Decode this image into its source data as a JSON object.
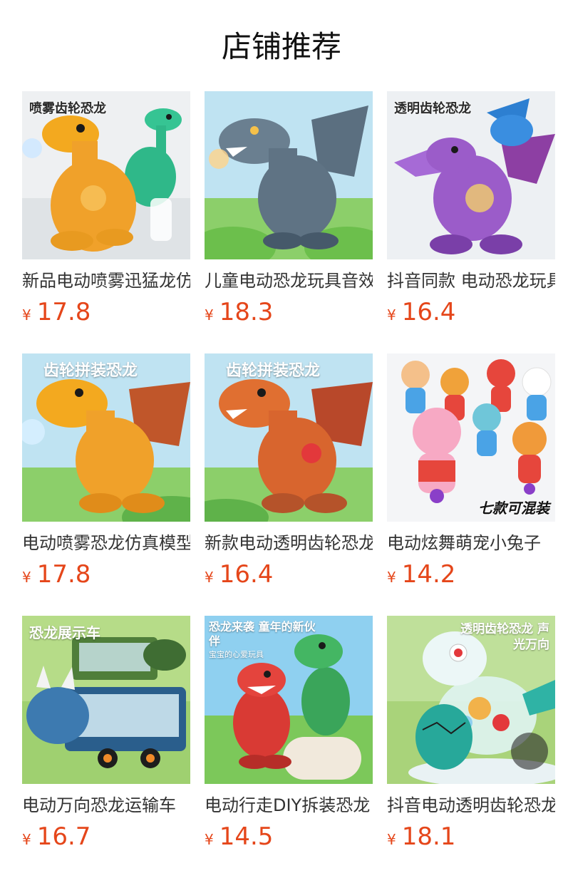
{
  "section": {
    "title": "店铺推荐"
  },
  "colors": {
    "price": "#e5461a",
    "title": "#111111",
    "name": "#333333"
  },
  "products": [
    {
      "name": "新品电动喷雾迅猛龙仿真模型",
      "currency": "¥",
      "price": "17.8",
      "image_label": "喷雾齿轮恐龙",
      "image_icon": "orange-dinosaur-image"
    },
    {
      "name": "儿童电动恐龙玩具音效",
      "currency": "¥",
      "price": "18.3",
      "image_label": "",
      "image_icon": "gray-dragon-dinosaur-image"
    },
    {
      "name": "抖音同款 电动恐龙玩具",
      "currency": "¥",
      "price": "16.4",
      "image_label": "透明齿轮恐龙",
      "image_icon": "purple-pterosaur-image"
    },
    {
      "name": "电动喷雾恐龙仿真模型",
      "currency": "¥",
      "price": "17.8",
      "image_label": "齿轮拼装恐龙",
      "image_icon": "yellow-dragon-dinosaur-image"
    },
    {
      "name": "新款电动透明齿轮恐龙",
      "currency": "¥",
      "price": "16.4",
      "image_label": "齿轮拼装恐龙",
      "image_icon": "orange-dragon-dinosaur-image"
    },
    {
      "name": "电动炫舞萌宠小兔子",
      "currency": "¥",
      "price": "14.2",
      "image_label": "七款可混装",
      "image_icon": "dancing-animal-toys-image"
    },
    {
      "name": "电动万向恐龙运输车",
      "currency": "¥",
      "price": "16.7",
      "image_label": "恐龙展示车",
      "image_icon": "dinosaur-truck-image"
    },
    {
      "name": "电动行走DIY拆装恐龙",
      "currency": "¥",
      "price": "14.5",
      "image_label": "恐龙来袭 童年的新伙伴",
      "image_sublabel": "宝宝的心爱玩具",
      "image_icon": "red-green-dinosaurs-image"
    },
    {
      "name": "抖音电动透明齿轮恐龙",
      "currency": "¥",
      "price": "18.1",
      "image_label": "透明齿轮恐龙 声光万向",
      "image_icon": "teal-dinosaur-egg-image"
    }
  ]
}
